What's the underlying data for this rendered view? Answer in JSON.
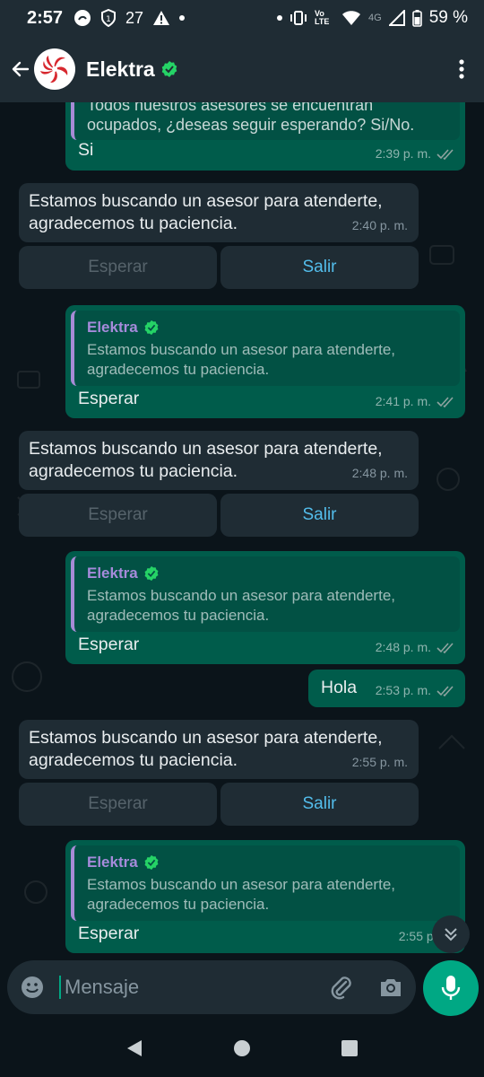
{
  "status": {
    "time": "2:57",
    "notif_count": "27",
    "battery": "59 %",
    "network": "4G",
    "volte": "Vo LTE"
  },
  "header": {
    "contact_name": "Elektra"
  },
  "messages": [
    {
      "id": "m1",
      "quote_text": "Todos nuestros asesores se encuentran ocupados, ¿deseas seguir esperando? Si/No.",
      "text": "Si",
      "time": "2:39 p. m."
    },
    {
      "id": "m2",
      "text": "Estamos buscando un asesor para atenderte, agradecemos tu paciencia.",
      "time": "2:40 p. m.",
      "buttons": [
        "Esperar",
        "Salir"
      ]
    },
    {
      "id": "m3",
      "quote_author": "Elektra",
      "quote_text": "Estamos buscando un asesor para atenderte, agradecemos tu paciencia.",
      "text": "Esperar",
      "time": "2:41 p. m."
    },
    {
      "id": "m4",
      "text": "Estamos buscando un asesor para atenderte, agradecemos tu paciencia.",
      "time": "2:48 p. m.",
      "buttons": [
        "Esperar",
        "Salir"
      ]
    },
    {
      "id": "m5",
      "quote_author": "Elektra",
      "quote_text": "Estamos buscando un asesor para atenderte, agradecemos tu paciencia.",
      "text": "Esperar",
      "time": "2:48 p. m."
    },
    {
      "id": "m6",
      "text": "Hola",
      "time": "2:53 p. m."
    },
    {
      "id": "m7",
      "text": "Estamos buscando un asesor para atenderte, agradecemos tu paciencia.",
      "time": "2:55 p. m.",
      "buttons": [
        "Esperar",
        "Salir"
      ]
    },
    {
      "id": "m8",
      "quote_author": "Elektra",
      "quote_text": "Estamos buscando un asesor para atenderte, agradecemos tu paciencia.",
      "text": "Esperar",
      "time": "2:55 p. m."
    }
  ],
  "input": {
    "placeholder": "Mensaje"
  },
  "colors": {
    "outgoing_bubble": "#005c4b",
    "incoming_bubble": "#1f2c34",
    "accent": "#00a884",
    "link": "#53bdeb",
    "quote_author": "#a68bdb"
  },
  "icons": {
    "back": "arrow-left-icon",
    "verified": "verified-badge-icon",
    "menu": "more-vertical-icon",
    "read": "double-check-icon",
    "emoji": "emoji-icon",
    "attach": "paperclip-icon",
    "camera": "camera-icon",
    "mic": "microphone-icon",
    "scroll": "chevrons-down-icon"
  }
}
